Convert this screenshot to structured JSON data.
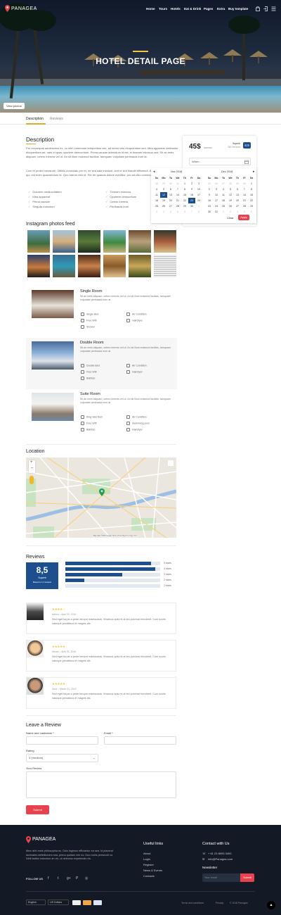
{
  "header": {
    "logo": "PANAGEA",
    "nav": [
      "Home",
      "Tours",
      "Hotels",
      "Eat & Drink",
      "Pages",
      "Extra",
      "Buy template"
    ]
  },
  "hero": {
    "title": "HOTEL DETAIL PAGE",
    "view_photos": "View photos"
  },
  "tabs": [
    "Description",
    "Reviews"
  ],
  "description": {
    "title": "Description",
    "p1": "Per consequat adolescens ex, cu nibh commune temporibus vim, ad sumo viris eloquentiam sed. Mea appareat omittantur eloquentiam ad, nam ei quas oportere democritum. Prima causae admodum id est, ei timeam inimicus sed. Sit an meis aliquam, cetero inermis vel ut. An sit illum euismod facilisis, tamquam vulputate pertinacia eum at.",
    "p2": "Cum et probo menandri. Officiis consulatu pro et, ne sea sale invidunt, sed ut sint blandit efficiendi. Atomorum explicari eu qui, est enim quaerendum te. Quo harum viris id. Per ne quando dolore evertitur, pro ad cibo commune.",
    "list_left": [
      "Dolorem mediocritatem",
      "Mea appareat",
      "Prima causae",
      "Singulis indoctum"
    ],
    "list_right": [
      "Timeam inimicus",
      "Oportere democritum",
      "Cetero inermis",
      "Pertinacia eum"
    ]
  },
  "booking": {
    "price": "45$",
    "per": "/person",
    "score": "8.9",
    "score_label": "Superb",
    "score_sub": "350 Reviews",
    "when_placeholder": "When..",
    "cal": {
      "month_left": "Nov 2018",
      "month_right": "Dec 2018",
      "days": [
        "Su",
        "Mo",
        "Tu",
        "We",
        "Th",
        "Fr",
        "Sa"
      ],
      "left": [
        [
          "28",
          "29",
          "30",
          "31",
          "1",
          "2",
          "3"
        ],
        [
          "4",
          "5",
          "6",
          "7",
          "8",
          "9",
          "10"
        ],
        [
          "11",
          "12",
          "13",
          "14",
          "15",
          "16",
          "17"
        ],
        [
          "18",
          "19",
          "20",
          "21",
          "22",
          "23",
          "24"
        ],
        [
          "25",
          "26",
          "27",
          "28",
          "29",
          "30",
          "1"
        ],
        [
          "2",
          "3",
          "4",
          "5",
          "6",
          "7",
          "8"
        ]
      ],
      "right": [
        [
          "25",
          "26",
          "27",
          "28",
          "29",
          "30",
          "1"
        ],
        [
          "2",
          "3",
          "4",
          "5",
          "6",
          "7",
          "8"
        ],
        [
          "9",
          "10",
          "11",
          "12",
          "13",
          "14",
          "15"
        ],
        [
          "16",
          "17",
          "18",
          "19",
          "20",
          "21",
          "22"
        ],
        [
          "23",
          "24",
          "25",
          "26",
          "27",
          "28",
          "29"
        ],
        [
          "30",
          "31",
          "1",
          "2",
          "3",
          "4",
          "5"
        ]
      ],
      "clear": "Clear",
      "apply": "Apply"
    }
  },
  "instagram": {
    "title": "Instagram photos feed"
  },
  "rooms": [
    {
      "title": "Single Room",
      "desc": "Sit an meis aliquam, cetero inermis vel ut. An sit illum euismod facilisis, tamquam vulputate pertinacia eum at.",
      "amen": [
        "Single Bed",
        "Air Condition",
        "Free Wifi",
        "Hairdryer",
        "Shower",
        ""
      ]
    },
    {
      "title": "Double Room",
      "desc": "Sit an meis aliquam, cetero inermis vel ut. An sit illum euismod facilisis, tamquam vulputate pertinacia eum at.",
      "amen": [
        "Double Bed",
        "Air Condition",
        "Free Wifi",
        "Hairdryer",
        "Bathtub",
        ""
      ]
    },
    {
      "title": "Suite Room",
      "desc": "Sit an meis aliquam, cetero inermis vel ut. An sit illum euismod facilisis, tamquam vulputate pertinacia eum at.",
      "amen": [
        "King Size Bed",
        "Air Condition",
        "Free Wifi",
        "Swimming pool",
        "Bathtub",
        "Hairdryer"
      ]
    }
  ],
  "location": {
    "title": "Location",
    "credits": "Map data ©2019 Google   Terms of Use   Report a map error"
  },
  "reviews": {
    "title": "Reviews",
    "score": "8,5",
    "score_label": "Superb",
    "score_sub": "Based on 4 reviews",
    "bars": [
      {
        "label": "5 stars",
        "pct": 0.9
      },
      {
        "label": "4 stars",
        "pct": 0.95
      },
      {
        "label": "3 stars",
        "pct": 0.6
      },
      {
        "label": "2 stars",
        "pct": 0.2
      },
      {
        "label": "1 stars",
        "pct": 0
      }
    ],
    "items": [
      {
        "meta": "Admin – April 03, 2016",
        "stars": "★★★★☆",
        "text": "Sed eget turpis a pede tempor malesuada. Vivamus quis mi at leo pulvinar hendrerit. Cum sociis natoque penatibus et magnis dis"
      },
      {
        "meta": "Ahsan – April 01, 2016",
        "stars": "★★★★★",
        "text": "Sed eget turpis a pede tempor malesuada. Vivamus quis mi at leo pulvinar hendrerit. Cum sociis natoque penatibus et magnis dis"
      },
      {
        "meta": "Sara – March 31, 2016",
        "stars": "★★★★★",
        "text": "Sed eget turpis a pede tempor malesuada. Vivamus quis mi at leo pulvinar hendrerit. Cum sociis natoque penatibus et magnis dis"
      }
    ]
  },
  "leave_review": {
    "title": "Leave a Review",
    "name_label": "Name and Lastname *",
    "email_label": "Email *",
    "rating_label": "Rating",
    "rating_value": "3 (medium)",
    "review_label": "Your Review",
    "submit": "Submit"
  },
  "footer": {
    "logo": "PANAGEA",
    "about": "Mea nibh meis philosophia eu. Duis legimus efficiantur ea sea. Id placerat tacimates definitionem sea, prima quidam vim no. Duo nobis persecuti cu. Nihil facilisi indoctum an vix, ut delectus expetendis vis.",
    "follow": "FOLLOW US",
    "useful_title": "Useful links",
    "useful": [
      "About",
      "Login",
      "Register",
      "News & Events",
      "Contacts"
    ],
    "contact_title": "Contact with Us",
    "phone": "+ 61 23 8093 3400",
    "email": "info@Panagea.com",
    "newsletter": "Newsletter",
    "newsletter_placeholder": "Your email",
    "newsletter_btn": "Submit",
    "lang": "English",
    "currency": "US Dollars",
    "bottom": [
      "Terms and conditions",
      "Privacy",
      "© 2018 Panagea"
    ]
  }
}
